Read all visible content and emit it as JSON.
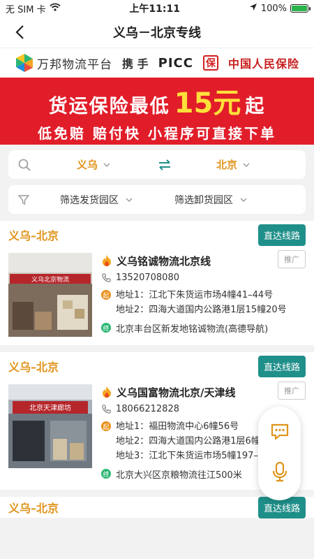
{
  "status_bar": {
    "carrier": "无 SIM 卡",
    "time": "上午11:11",
    "battery": "100%"
  },
  "nav": {
    "title": "义乌－北京专线"
  },
  "partner_banner": {
    "platform": "万邦物流平台",
    "with": "携 手",
    "insurer": "PICC",
    "insurer_seal": "保",
    "insurer_name": "中国人民保险"
  },
  "promo_banner": {
    "line1_prefix": "货运保险最低",
    "price": "15元",
    "line1_suffix": "起",
    "line2": "低免赔 赔付快 小程序可直接下单"
  },
  "route": {
    "from": "义乌",
    "to": "北京"
  },
  "filters": {
    "load_park": "筛选发货园区",
    "unload_park": "筛选卸货园区"
  },
  "cards": [
    {
      "route": "义乌–北京",
      "direct_label": "直达线路",
      "photo_sign": "义乌北京物流",
      "name": "义乌铭诚物流北京线",
      "promo_tag": "推广",
      "phone": "13520708080",
      "start_badge": "起",
      "end_badge": "终",
      "addresses": [
        "地址1：江北下朱货运市场4幢41–44号",
        "地址2：四海大道国内公路港1层15幢20号"
      ],
      "destination": "北京丰台区新发地铭诚物流(高德导航)"
    },
    {
      "route": "义乌–北京",
      "direct_label": "直达线路",
      "photo_sign": "北京天津廊坊",
      "name": "义乌国富物流北京/天津线",
      "promo_tag": "推广",
      "phone": "18066212828",
      "start_badge": "起",
      "end_badge": "终",
      "addresses": [
        "地址1：福田物流中心6幢56号",
        "地址2：四海大道国内公路港1层6幢",
        "地址3：江北下朱货运市场5幢197–198号"
      ],
      "destination": "北京大兴区京粮物流往江500米"
    }
  ],
  "partial_card": {
    "route": "义乌–北京",
    "direct_label": "直达线路"
  },
  "colors": {
    "accent_orange": "#e0941b",
    "teal": "#1f8f8a",
    "banner_red": "#e11d2a",
    "price_yellow": "#ffe03a"
  }
}
